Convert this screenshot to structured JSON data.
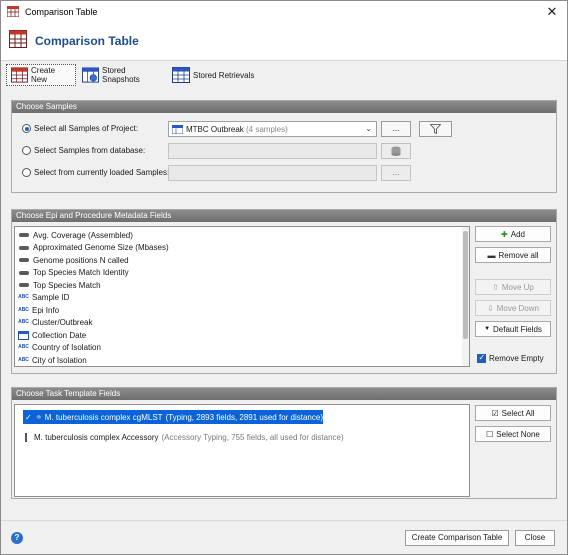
{
  "window": {
    "title": "Comparison Table",
    "close_glyph": "✕"
  },
  "header": {
    "title": "Comparison Table",
    "icon": "comparison-table-icon"
  },
  "tabs": [
    {
      "label": "Create New",
      "active": true,
      "icon": "table-grid-icon"
    },
    {
      "label": "Stored Snapshots",
      "active": false,
      "icon": "snapshot-icon"
    },
    {
      "label": "Stored Retrievals",
      "active": false,
      "icon": "retrieval-icon"
    }
  ],
  "choose_samples": {
    "heading": "Choose Samples",
    "option_project": "Select all Samples of Project:",
    "option_database": "Select Samples from database:",
    "option_loaded": "Select from currently loaded Samples:",
    "project_value": "MTBC Outbreak",
    "project_count": "(4 samples)",
    "browse": "...",
    "selected_option": "project"
  },
  "epi_fields": {
    "heading": "Choose Epi and Procedure Metadata Fields",
    "items": [
      {
        "label": "Avg. Coverage (Assembled)",
        "type": "numeric"
      },
      {
        "label": "Approximated Genome Size (Mbases)",
        "type": "numeric"
      },
      {
        "label": "Genome positions N called",
        "type": "numeric"
      },
      {
        "label": "Top Species Match Identity",
        "type": "numeric"
      },
      {
        "label": "Top Species Match",
        "type": "numeric"
      },
      {
        "label": "Sample ID",
        "type": "text"
      },
      {
        "label": "Epi Info",
        "type": "text"
      },
      {
        "label": "Cluster/Outbreak",
        "type": "text"
      },
      {
        "label": "Collection Date",
        "type": "date"
      },
      {
        "label": "Country of Isolation",
        "type": "text"
      },
      {
        "label": "City of Isolation",
        "type": "text"
      }
    ],
    "buttons": {
      "add": "Add",
      "remove_all": "Remove all",
      "move_up": "Move Up",
      "move_down": "Move Down",
      "default_fields": "Default Fields"
    },
    "remove_empty_label": "Remove Empty",
    "remove_empty_checked": true
  },
  "task_fields": {
    "heading": "Choose Task Template Fields",
    "items": [
      {
        "name": "M. tuberculosis complex cgMLST",
        "detail": "(Typing, 2893 fields, 2891 used for distance)",
        "checked": true,
        "selected": true
      },
      {
        "name": "M. tuberculosis complex Accessory",
        "detail": "(Accessory Typing, 755 fields, all used for distance)",
        "checked": false,
        "selected": false
      }
    ],
    "select_all": "Select All",
    "select_none": "Select None"
  },
  "footer": {
    "create": "Create Comparison Table",
    "close": "Close",
    "help": "?"
  }
}
